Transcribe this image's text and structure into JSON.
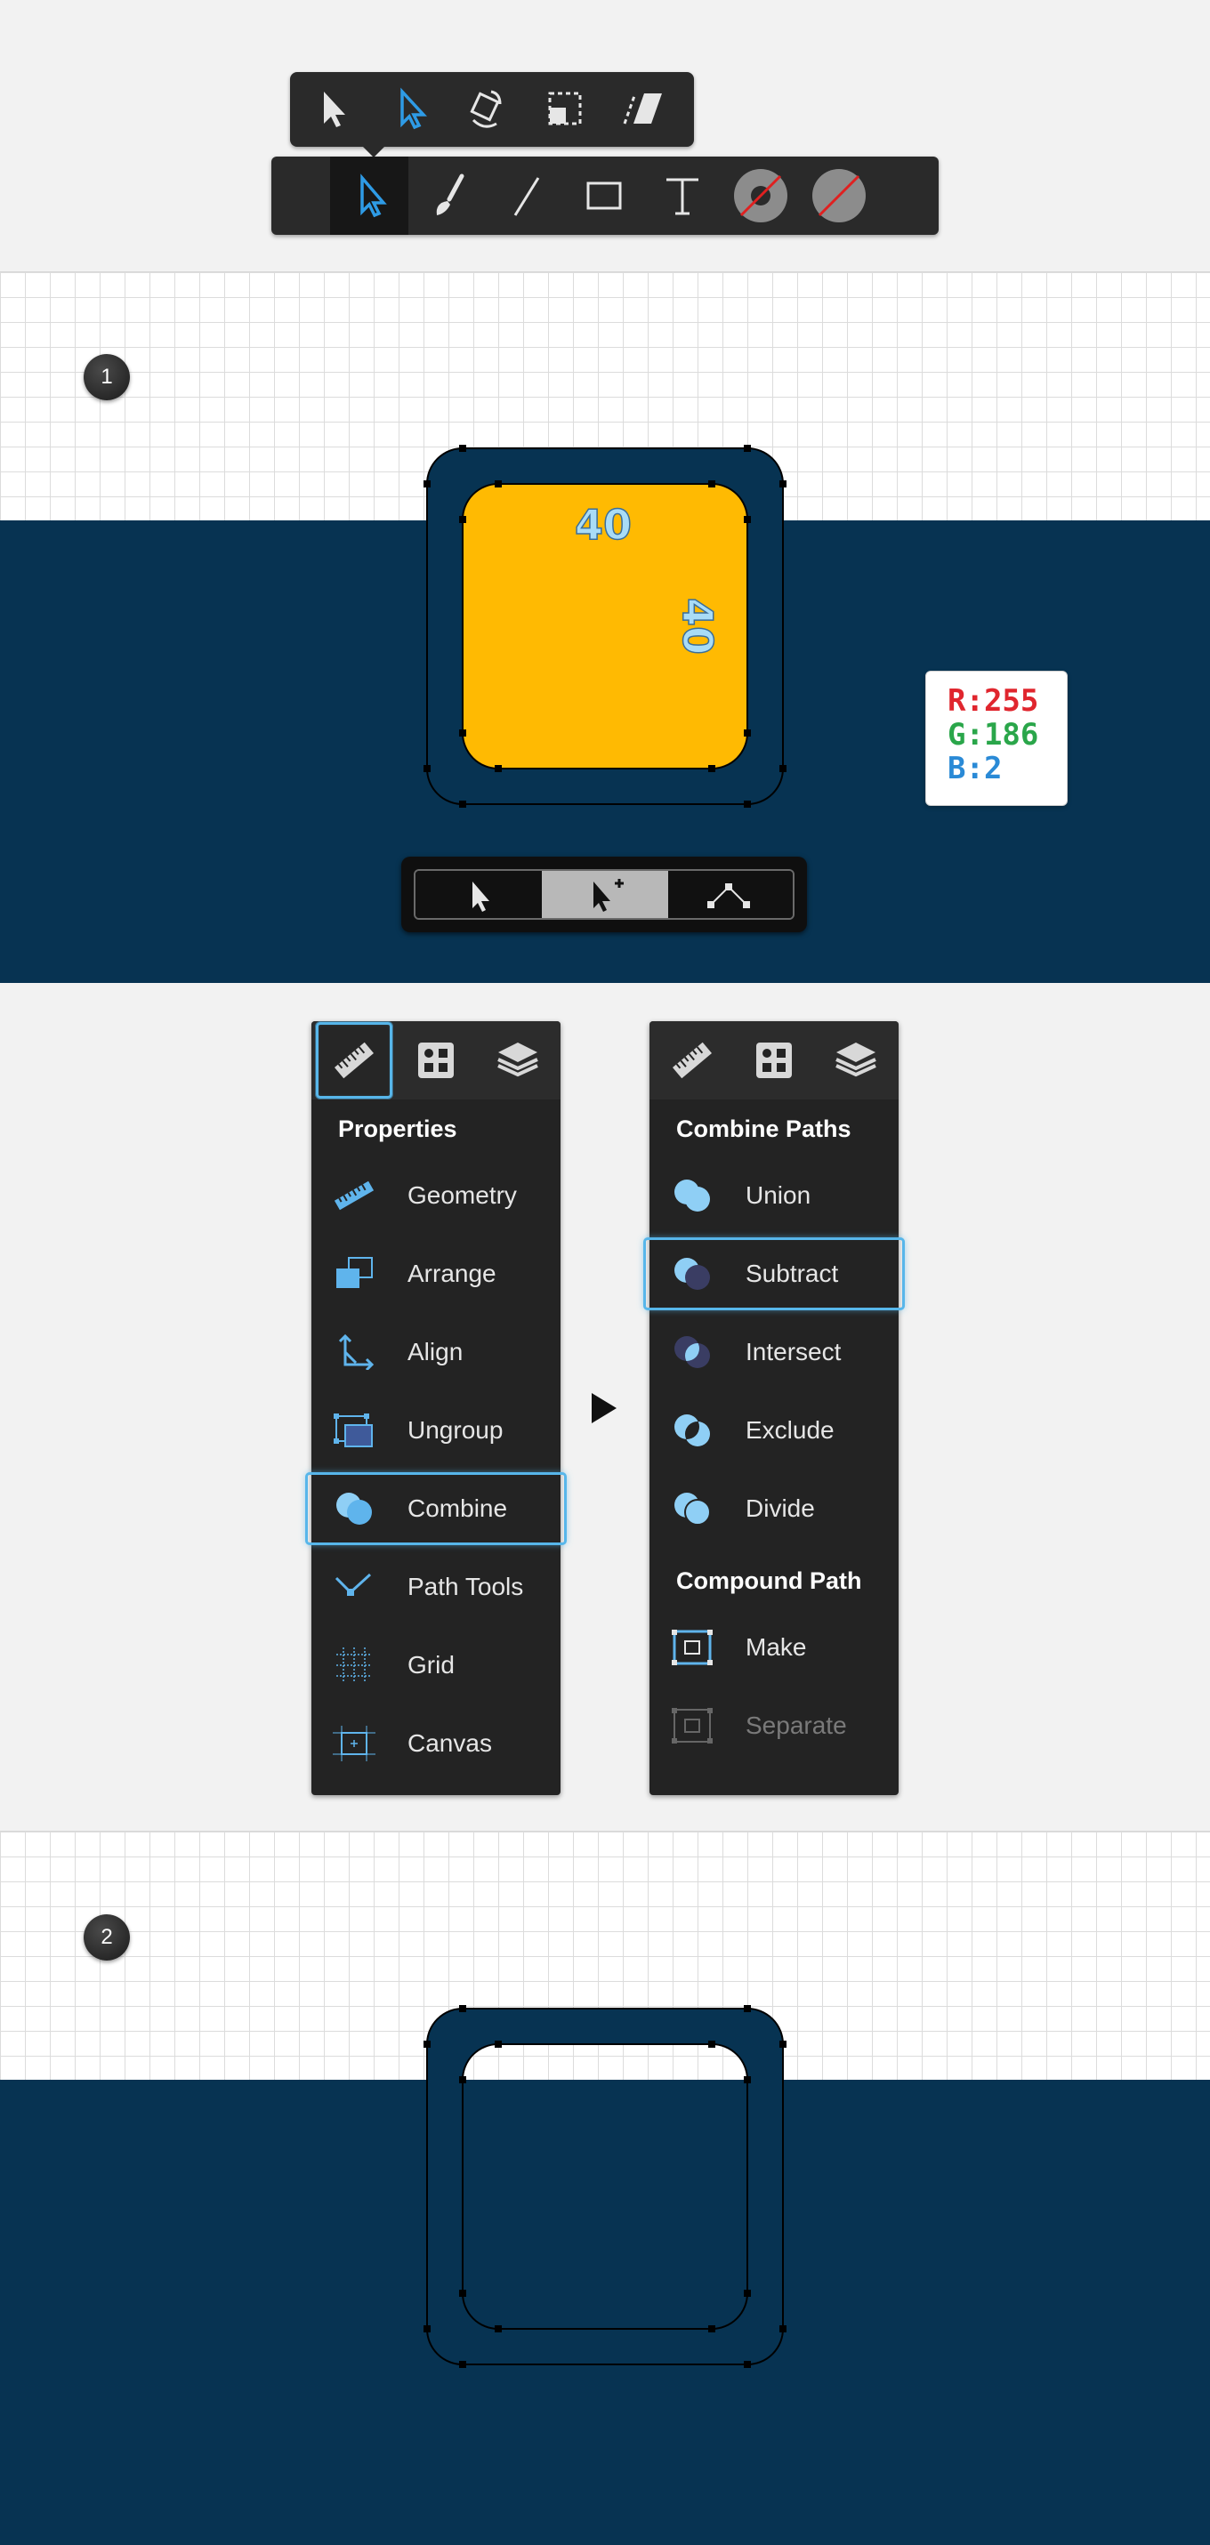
{
  "toolbars": {
    "sub_tools": [
      {
        "name": "selection-arrow",
        "active": false
      },
      {
        "name": "direct-selection-arrow",
        "active": true
      },
      {
        "name": "rotate-transform",
        "active": false
      },
      {
        "name": "mask-transform",
        "active": false
      },
      {
        "name": "skew-transform",
        "active": false
      }
    ],
    "main_tools": [
      {
        "name": "selection-tool",
        "active": true
      },
      {
        "name": "brush-tool",
        "active": false
      },
      {
        "name": "line-tool",
        "active": false
      },
      {
        "name": "rectangle-tool",
        "active": false
      },
      {
        "name": "text-tool",
        "active": false
      },
      {
        "name": "stroke-color",
        "active": false
      },
      {
        "name": "fill-color",
        "active": false
      }
    ]
  },
  "step1": {
    "badge": "1",
    "corner_radius_top": "40",
    "corner_radius_side": "40",
    "colors": {
      "navy": "#073352",
      "yellow": "#FFBA02",
      "accent": "#57B6EA"
    },
    "color_card": {
      "r": "R:255",
      "g": "G:186",
      "b": "B:2"
    },
    "mini_tools": [
      "select-icon",
      "add-anchor-icon",
      "node-icon"
    ],
    "mini_active_index": 1
  },
  "left_panel": {
    "tabs": [
      "ruler-icon",
      "shapes-icon",
      "layers-icon"
    ],
    "heading": "Properties",
    "items": [
      {
        "label": "Geometry",
        "icon": "ruler-icon"
      },
      {
        "label": "Arrange",
        "icon": "arrange-icon"
      },
      {
        "label": "Align",
        "icon": "align-icon"
      },
      {
        "label": "Ungroup",
        "icon": "ungroup-icon"
      },
      {
        "label": "Combine",
        "icon": "combine-icon",
        "highlighted": true
      },
      {
        "label": "Path Tools",
        "icon": "path-tools-icon"
      },
      {
        "label": "Grid",
        "icon": "grid-icon"
      },
      {
        "label": "Canvas",
        "icon": "canvas-icon"
      }
    ]
  },
  "right_panel": {
    "tabs": [
      "ruler-icon",
      "shapes-icon",
      "layers-icon"
    ],
    "heading_combine": "Combine Paths",
    "combine_items": [
      {
        "label": "Union",
        "icon": "union-icon"
      },
      {
        "label": "Subtract",
        "icon": "subtract-icon",
        "highlighted": true
      },
      {
        "label": "Intersect",
        "icon": "intersect-icon"
      },
      {
        "label": "Exclude",
        "icon": "exclude-icon"
      },
      {
        "label": "Divide",
        "icon": "divide-icon"
      }
    ],
    "heading_compound": "Compound Path",
    "compound_items": [
      {
        "label": "Make",
        "icon": "make-icon"
      },
      {
        "label": "Separate",
        "icon": "separate-icon",
        "disabled": true
      }
    ]
  },
  "step2": {
    "badge": "2"
  }
}
